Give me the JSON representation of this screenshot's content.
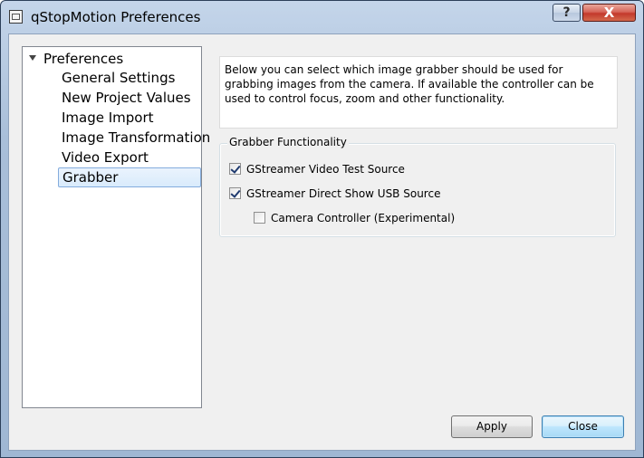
{
  "window": {
    "title": "qStopMotion Preferences",
    "help_label": "?",
    "close_label": "X"
  },
  "tree": {
    "root_label": "Preferences",
    "items": [
      {
        "label": "General Settings"
      },
      {
        "label": "New Project Values"
      },
      {
        "label": "Image Import"
      },
      {
        "label": "Image Transformation"
      },
      {
        "label": "Video Export"
      },
      {
        "label": "Grabber",
        "selected": true
      }
    ]
  },
  "description": "Below you can select which image grabber should be used for grabbing images from the camera. If available the controller can be used to control focus, zoom and other functionality.",
  "grabber_group": {
    "title": "Grabber Functionality",
    "options": [
      {
        "label": "GStreamer Video Test Source",
        "checked": true
      },
      {
        "label": "GStreamer Direct Show USB Source",
        "checked": true
      },
      {
        "label": "Camera Controller (Experimental)",
        "checked": false
      }
    ]
  },
  "buttons": {
    "apply": "Apply",
    "close": "Close"
  }
}
